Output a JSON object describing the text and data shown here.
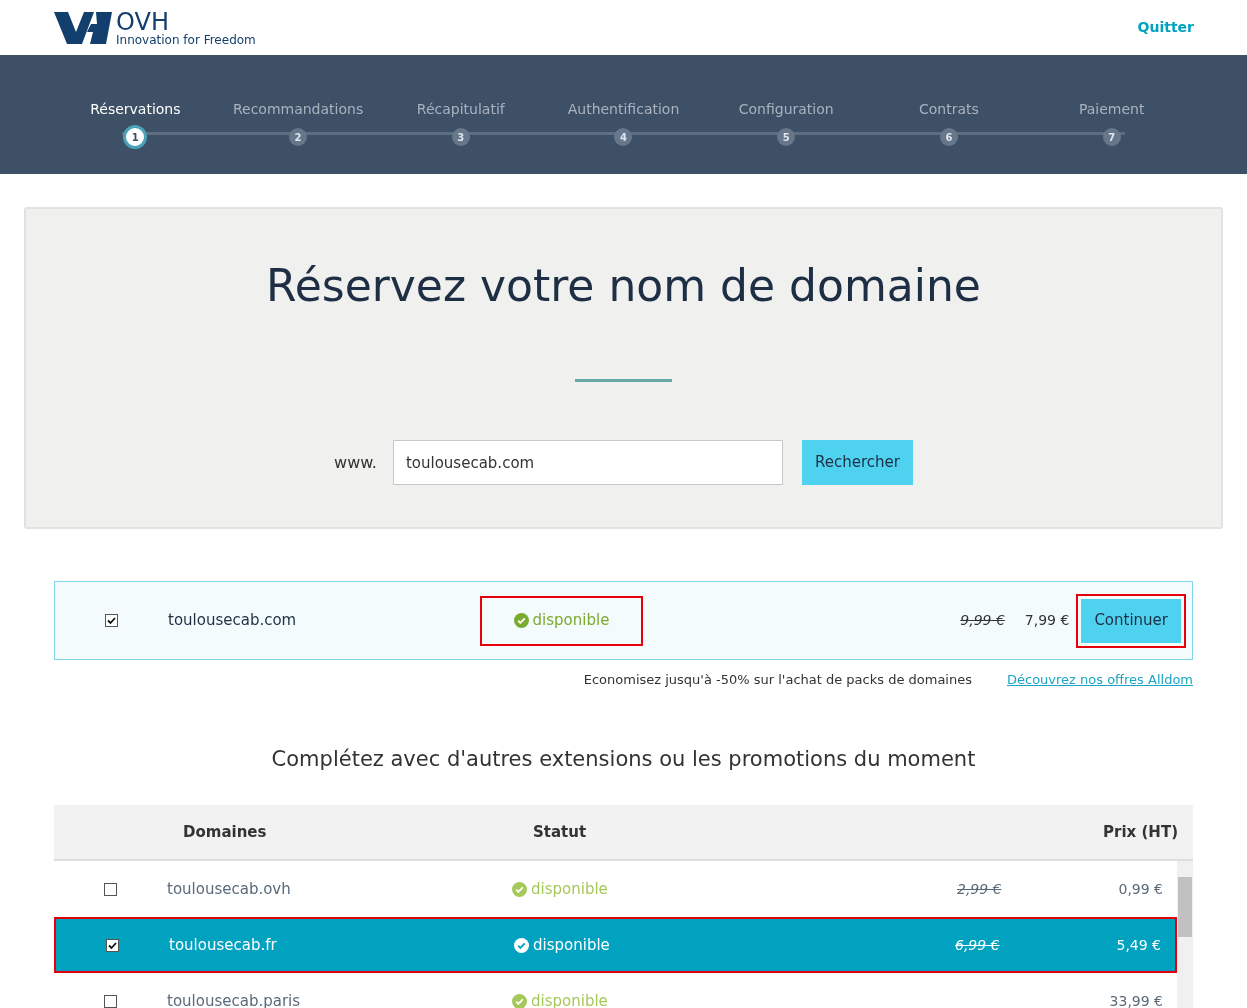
{
  "header": {
    "logo_name": "OVH",
    "logo_tagline": "Innovation for Freedom",
    "quit_link": "Quitter"
  },
  "steps": [
    {
      "label": "Réservations",
      "number": "1",
      "selected": true
    },
    {
      "label": "Recommandations",
      "number": "2",
      "selected": false
    },
    {
      "label": "Récapitulatif",
      "number": "3",
      "selected": false
    },
    {
      "label": "Authentification",
      "number": "4",
      "selected": false
    },
    {
      "label": "Configuration",
      "number": "5",
      "selected": false
    },
    {
      "label": "Contrats",
      "number": "6",
      "selected": false
    },
    {
      "label": "Paiement",
      "number": "7",
      "selected": false
    }
  ],
  "hero": {
    "title": "Réservez votre nom de domaine",
    "prefix": "www.",
    "search_value": "toulousecab.com",
    "search_button": "Rechercher"
  },
  "result": {
    "checked": true,
    "domain": "toulousecab.com",
    "status": "disponible",
    "status_highlighted": true,
    "old_price": "9,99 €",
    "price": "7,99 €",
    "continue_button": "Continuer",
    "button_highlighted": true
  },
  "promo": {
    "text": "Economisez jusqu'à -50% sur l'achat de packs de domaines",
    "link": "Découvrez nos offres Alldom"
  },
  "extensions_title": "Complétez avec d'autres extensions ou les promotions du moment",
  "table": {
    "columns": [
      "Domaines",
      "Statut",
      "Prix (HT)"
    ],
    "rows": [
      {
        "checked": false,
        "selected": false,
        "domain": "toulousecab.ovh",
        "status": "disponible",
        "old_price": "2,99 €",
        "price": "0,99 €"
      },
      {
        "checked": true,
        "selected": true,
        "domain": "toulousecab.fr",
        "status": "disponible",
        "old_price": "6,99 €",
        "price": "5,49 €"
      },
      {
        "checked": false,
        "selected": false,
        "domain": "toulousecab.paris",
        "status": "disponible",
        "price": "33,99 €"
      }
    ]
  }
}
